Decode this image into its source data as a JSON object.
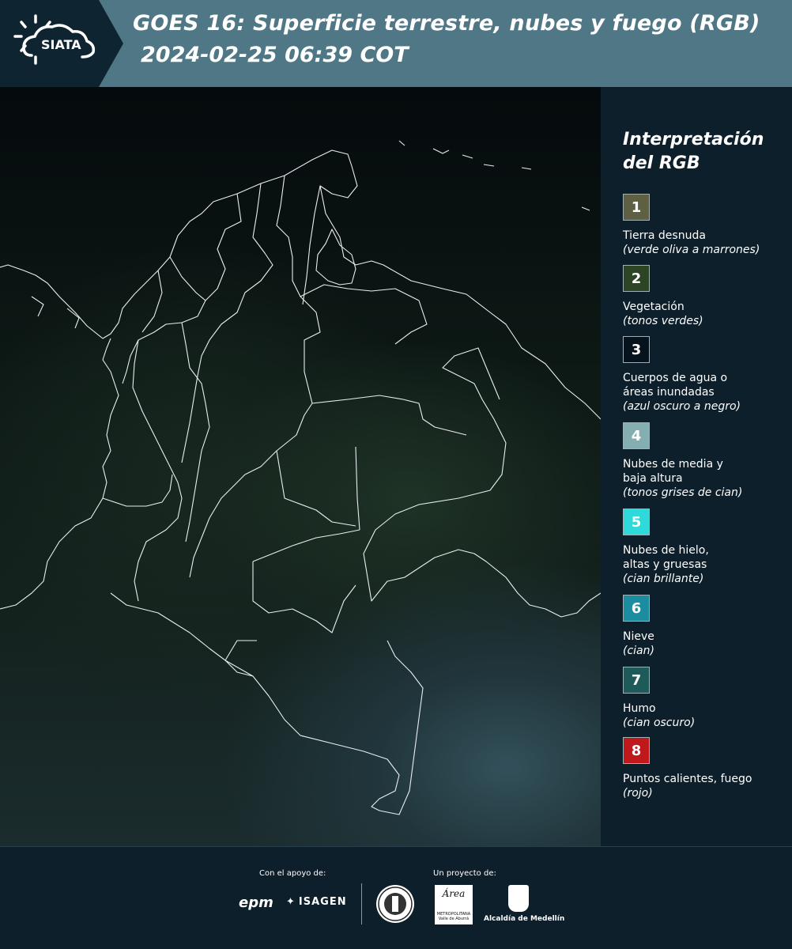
{
  "header": {
    "logo_text": "SIATA",
    "title_line1": "GOES 16: Superficie terrestre, nubes y fuego (RGB)",
    "title_line2": "2024-02-25 06:39 COT",
    "background_color": "#4f7785"
  },
  "legend": {
    "title": "Interpretación del RGB",
    "items": [
      {
        "number": "1",
        "label": "Tierra desnuda",
        "note": "(verde oliva a marrones)",
        "color": "#5e5f43"
      },
      {
        "number": "2",
        "label": "Vegetación",
        "note": "(tonos verdes)",
        "color": "#2d4525"
      },
      {
        "number": "3",
        "label": "Cuerpos de agua o áreas inundadas",
        "note": "(azul oscuro a negro)",
        "color": "#07131c"
      },
      {
        "number": "4",
        "label": "Nubes de media y baja altura",
        "note": "(tonos grises de cian)",
        "color": "#84aeb0"
      },
      {
        "number": "5",
        "label": "Nubes de hielo, altas y gruesas",
        "note": "(cian brillante)",
        "color": "#2ed9da"
      },
      {
        "number": "6",
        "label": "Nieve",
        "note": "(cian)",
        "color": "#1c8da0"
      },
      {
        "number": "7",
        "label": "Humo",
        "note": "(cian oscuro)",
        "color": "#1e5a5a"
      },
      {
        "number": "8",
        "label": "Puntos calientes, fuego",
        "note": "(rojo)",
        "color": "#c0191b"
      }
    ]
  },
  "footer": {
    "support_label": "Con el apoyo de:",
    "project_label": "Un proyecto de:",
    "epm_text": "epm",
    "isagen_text": "ISAGEN",
    "area_text": "Área",
    "area_subtext": "METROPOLITANA Valle de Aburrá",
    "alcaldia_text": "Alcaldía de Medellín"
  }
}
